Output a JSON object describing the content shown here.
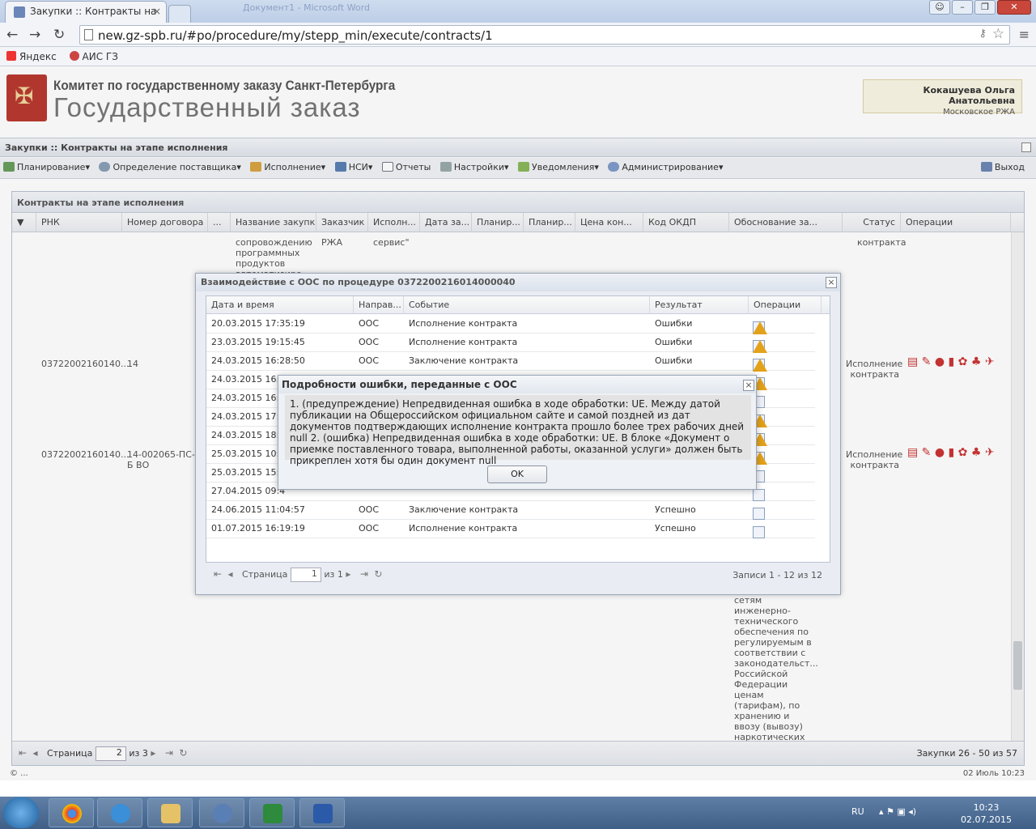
{
  "browser": {
    "tab_title": "Закупки :: Контракты на",
    "bg_window": "Документ1 - Microsoft Word",
    "url": "new.gz-spb.ru/#po/procedure/my/stepp_min/execute/contracts/1",
    "bookmarks": [
      "Яндекс",
      "АИС ГЗ"
    ]
  },
  "header": {
    "org": "Комитет по государственному заказу Санкт-Петербурга",
    "site": "Государственный заказ",
    "user_name": "Кокашуева Ольга Анатольевна",
    "user_org": "Московское РЖА"
  },
  "panel_title": "Закупки :: Контракты на этапе исполнения",
  "toolbar": {
    "items": [
      "Планирование",
      "Определение поставщика",
      "Исполнение",
      "НСИ",
      "Отчеты",
      "Настройки",
      "Уведомления",
      "Администрирование"
    ],
    "logout": "Выход"
  },
  "grid": {
    "title": "Контракты на этапе исполнения",
    "columns": [
      "РНК",
      "Номер договора",
      "...",
      "Название закупки",
      "Заказчик",
      "Исполн...",
      "Дата за...",
      "Планир...",
      "Планир...",
      "Цена кон...",
      "Код ОКДП",
      "Обоснование за...",
      "Статус",
      "Операции"
    ],
    "row0": {
      "name": "сопровождению программных продуктов автоматизиро...",
      "customer": "РЖА",
      "executor": "сервис\"",
      "status": "контракта"
    },
    "row1": {
      "rnk": "03722002160140...",
      "num": "14",
      "status": "Исполнение контракта"
    },
    "row2": {
      "rnk": "03722002160140...",
      "num": "14-002065-ПС-Б ВО",
      "status": "Исполнение контракта"
    },
    "basis_text": "сетям инженерно-технического обеспечения по регулируемым в соответствии с законодательст... Российской Федерации ценам (тарифам), по хранению и ввозу (вывозу) наркотических средств и психотропных",
    "pager": {
      "page_label": "Страница",
      "page": "2",
      "of": "из 3",
      "records": "Закупки 26 - 50 из 57"
    }
  },
  "status": {
    "left": "© ...",
    "right": "02 Июль 10:23"
  },
  "dialog1": {
    "title": "Взаимодействие с ООС по процедуре 0372200216014000040",
    "columns": [
      "Дата и время",
      "Направ...",
      "Событие",
      "Результат",
      "Операции"
    ],
    "rows": [
      {
        "date": "20.03.2015 17:35:19",
        "dir": "ООС",
        "event": "Исполнение контракта",
        "result": "Ошибки"
      },
      {
        "date": "23.03.2015 19:15:45",
        "dir": "ООС",
        "event": "Исполнение контракта",
        "result": "Ошибки"
      },
      {
        "date": "24.03.2015 16:28:50",
        "dir": "ООС",
        "event": "Заключение контракта",
        "result": "Ошибки"
      },
      {
        "date": "24.03.2015 16:34:01",
        "dir": "",
        "event": "",
        "result": ""
      },
      {
        "date": "24.03.2015 16:4",
        "dir": "",
        "event": "",
        "result": ""
      },
      {
        "date": "24.03.2015 17:2",
        "dir": "",
        "event": "",
        "result": ""
      },
      {
        "date": "24.03.2015 18:0",
        "dir": "",
        "event": "",
        "result": ""
      },
      {
        "date": "25.03.2015 10:2",
        "dir": "",
        "event": "",
        "result": ""
      },
      {
        "date": "25.03.2015 15:4",
        "dir": "",
        "event": "",
        "result": ""
      },
      {
        "date": "27.04.2015 09:4",
        "dir": "",
        "event": "",
        "result": ""
      },
      {
        "date": "24.06.2015 11:04:57",
        "dir": "ООС",
        "event": "Заключение контракта",
        "result": "Успешно"
      },
      {
        "date": "01.07.2015 16:19:19",
        "dir": "ООС",
        "event": "Исполнение контракта",
        "result": "Успешно"
      }
    ],
    "pager": {
      "page_label": "Страница",
      "page": "1",
      "of": "из 1",
      "records": "Записи 1 - 12 из 12"
    }
  },
  "dialog2": {
    "title": "Подробности ошибки, переданные с ООС",
    "message": "1. (предупреждение) Непредвиденная ошибка в ходе обработки: UE. Между датой публикации на Общероссийском официальном сайте и самой поздней из дат документов подтверждающих исполнение контракта прошло более трех рабочих дней null 2. (ошибка) Непредвиденная ошибка в ходе обработки: UE. В блоке «Документ о приемке поставленного товара, выполненной работы, оказанной услуги» должен быть прикреплен хотя бы один документ null",
    "ok": "OK"
  },
  "taskbar": {
    "lang": "RU",
    "time": "10:23",
    "date": "02.07.2015"
  }
}
